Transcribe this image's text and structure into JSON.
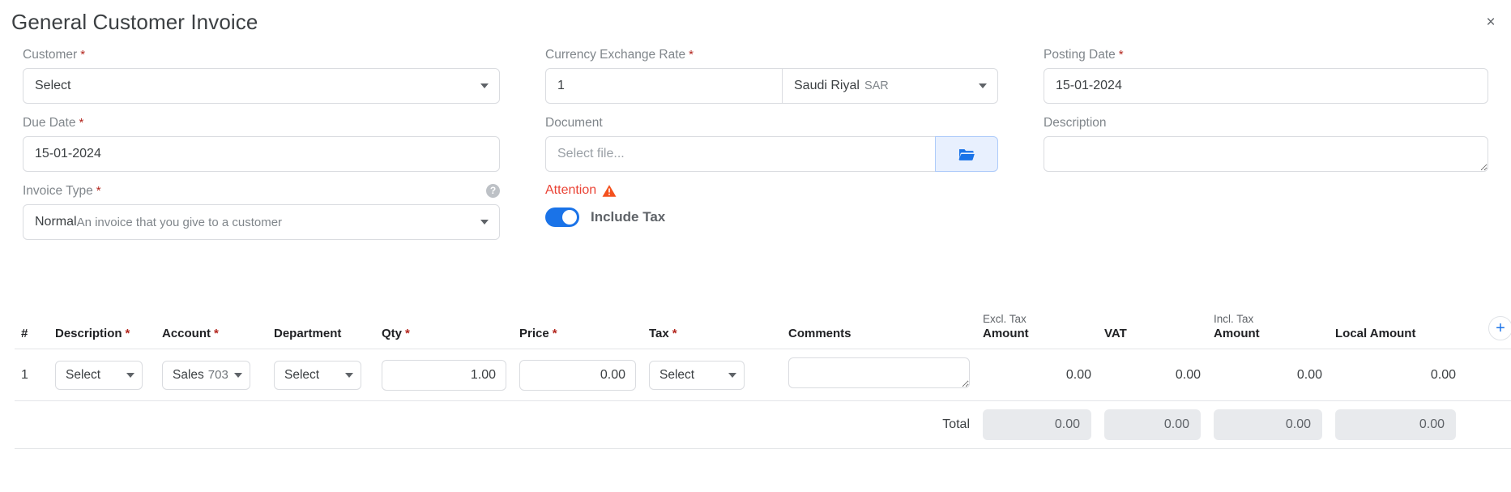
{
  "modal": {
    "title": "General Customer Invoice",
    "close_label": "×"
  },
  "form": {
    "customer": {
      "label": "Customer",
      "required": "*",
      "value": "Select"
    },
    "currency_exchange_rate": {
      "label": "Currency Exchange Rate",
      "required": "*",
      "value": "1",
      "currency_name": "Saudi Riyal",
      "currency_code": "SAR"
    },
    "posting_date": {
      "label": "Posting Date",
      "required": "*",
      "value": "15-01-2024"
    },
    "due_date": {
      "label": "Due Date",
      "required": "*",
      "value": "15-01-2024"
    },
    "document": {
      "label": "Document",
      "placeholder": "Select file...",
      "value": "",
      "browse_icon": "folder-open-icon"
    },
    "description": {
      "label": "Description",
      "value": "",
      "placeholder": ""
    },
    "invoice_type": {
      "label": "Invoice Type",
      "required": "*",
      "help_icon": "?",
      "value_main": "Normal",
      "value_sub": "An invoice that you give to a customer"
    },
    "attention": {
      "label": "Attention",
      "warning_icon": "warning-triangle-icon",
      "toggle_label": "Include Tax",
      "toggle_on": true
    }
  },
  "items_table": {
    "headers": [
      {
        "sup": "",
        "label": "#",
        "required": ""
      },
      {
        "sup": "",
        "label": "Description",
        "required": "*"
      },
      {
        "sup": "",
        "label": "Account",
        "required": "*"
      },
      {
        "sup": "",
        "label": "Department",
        "required": ""
      },
      {
        "sup": "",
        "label": "Qty",
        "required": "*"
      },
      {
        "sup": "",
        "label": "Price",
        "required": "*"
      },
      {
        "sup": "",
        "label": "Tax",
        "required": "*"
      },
      {
        "sup": "",
        "label": "Comments",
        "required": ""
      },
      {
        "sup": "Excl. Tax",
        "label": "Amount",
        "required": ""
      },
      {
        "sup": "",
        "label": "VAT",
        "required": ""
      },
      {
        "sup": "Incl. Tax",
        "label": "Amount",
        "required": ""
      },
      {
        "sup": "",
        "label": "Local Amount",
        "required": ""
      }
    ],
    "add_row_label": "+",
    "rows": [
      {
        "index": "1",
        "description": "Select",
        "account_name": "Sales",
        "account_code": "703",
        "department": "Select",
        "qty": "1.00",
        "price": "0.00",
        "tax": "Select",
        "comments": "",
        "excl_tax_amount": "0.00",
        "vat": "0.00",
        "incl_tax_amount": "0.00",
        "local_amount": "0.00"
      }
    ],
    "totals": {
      "label": "Total",
      "excl_tax_amount": "0.00",
      "vat": "0.00",
      "incl_tax_amount": "0.00",
      "local_amount": "0.00"
    }
  },
  "colors": {
    "accent": "#1a73e8",
    "required": "#b3261e",
    "attention": "#ea4335",
    "warning": "#f4511e",
    "border": "#dadce0",
    "total_bg": "#e8eaed"
  }
}
